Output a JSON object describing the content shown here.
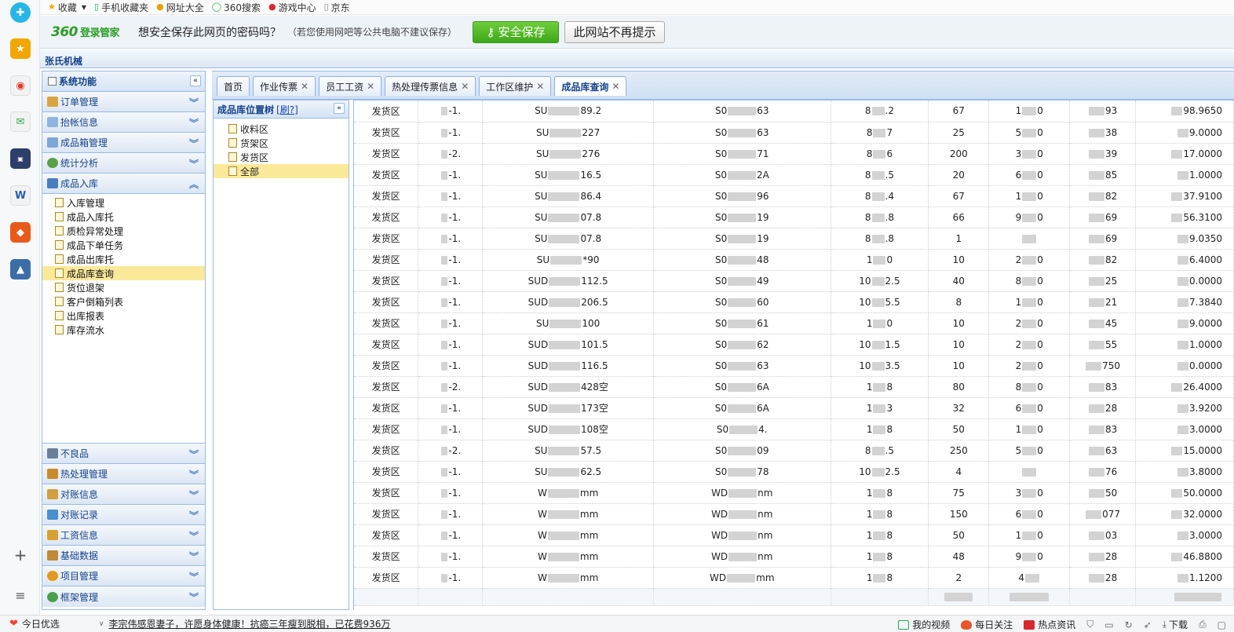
{
  "favorites": {
    "items": [
      {
        "label": "收藏",
        "icon": "star-icon"
      },
      {
        "label": "手机收藏夹",
        "icon": "phone-icon"
      },
      {
        "label": "网址大全",
        "icon": "web-directory-icon"
      },
      {
        "label": "360搜索",
        "icon": "search-360-icon"
      },
      {
        "label": "游戏中心",
        "icon": "game-center-icon"
      },
      {
        "label": "京东",
        "icon": "page-icon"
      }
    ]
  },
  "notice": {
    "brand": "360",
    "brand_sub": "登录管家",
    "question": "想安全保存此网页的密码吗？",
    "hint": "（若您使用网吧等公共电脑不建议保存）",
    "save_button": "安全保存",
    "never_button": "此网站不再提示"
  },
  "app": {
    "title": "张氏机械"
  },
  "menu": {
    "header": "系统功能",
    "sections_top": [
      {
        "label": "订单管理",
        "icon": "order-icon",
        "color": "#d9a441"
      },
      {
        "label": "抬帐信息",
        "icon": "mail-icon",
        "color": "#8fb4de"
      },
      {
        "label": "成品箱管理",
        "icon": "box-icon",
        "color": "#7ea6d6"
      },
      {
        "label": "统计分析",
        "icon": "pie-chart-icon",
        "color": "#5aa04a"
      }
    ],
    "open_section": {
      "label": "成品入库",
      "icon": "book-icon"
    },
    "sub_items": [
      "入库管理",
      "成品入库托",
      "质检异常处理",
      "成品下单任务",
      "成品出库托",
      "成品库查询",
      "货位退架",
      "客户倒箱列表",
      "出库报表",
      "库存流水"
    ],
    "selected_sub": "成品库查询",
    "sections_bottom": [
      {
        "label": "不良品",
        "icon": "user-icon",
        "color": "#6b7f99"
      },
      {
        "label": "热处理管理",
        "icon": "folder-icon",
        "color": "#c98a2c"
      },
      {
        "label": "对账信息",
        "icon": "edit-icon",
        "color": "#d0a040"
      },
      {
        "label": "对账记录",
        "icon": "check-icon",
        "color": "#4a8fd0"
      },
      {
        "label": "工资信息",
        "icon": "people-icon",
        "color": "#d8a030"
      },
      {
        "label": "基础数据",
        "icon": "wrench-icon",
        "color": "#c08a3a"
      },
      {
        "label": "项目管理",
        "icon": "gear-icon",
        "color": "#e29a1e"
      },
      {
        "label": "框架管理",
        "icon": "plus-circle-icon",
        "color": "#4aa04a"
      }
    ]
  },
  "tabs": [
    {
      "label": "首页",
      "closable": false
    },
    {
      "label": "作业传票",
      "closable": true
    },
    {
      "label": "员工工资",
      "closable": true
    },
    {
      "label": "热处理传票信息",
      "closable": true
    },
    {
      "label": "工作区维护",
      "closable": true
    },
    {
      "label": "成品库查询",
      "closable": true,
      "active": true
    }
  ],
  "tree": {
    "title": "成品库位置树",
    "refresh_label": "[刷?]",
    "nodes": [
      "收料区",
      "货架区",
      "发货区",
      "全部"
    ],
    "selected": "全部"
  },
  "grid": {
    "rows": [
      [
        "发货区",
        "-1.",
        "SU",
        "89.2",
        "S0",
        "63",
        "8",
        ".2",
        "67",
        "1",
        "0",
        "93",
        "98.9650"
      ],
      [
        "发货区",
        "-1.",
        "SU",
        "227",
        "S0",
        "63",
        "8",
        "7",
        "25",
        "5",
        "0",
        "38",
        "9.0000"
      ],
      [
        "发货区",
        "-2.",
        "SU",
        "276",
        "S0",
        "71",
        "8",
        "6",
        "200",
        "3",
        "0",
        "39",
        "17.0000"
      ],
      [
        "发货区",
        "-1.",
        "SU",
        "16.5",
        "S0",
        "2A",
        "8",
        ".5",
        "20",
        "6",
        "0",
        "85",
        "1.0000"
      ],
      [
        "发货区",
        "-1.",
        "SU",
        "86.4",
        "S0",
        "96",
        "8",
        ".4",
        "67",
        "1",
        "0",
        "82",
        "37.9100"
      ],
      [
        "发货区",
        "-1.",
        "SU",
        "07.8",
        "S0",
        "19",
        "8",
        ".8",
        "66",
        "9",
        "0",
        "69",
        "56.3100"
      ],
      [
        "发货区",
        "-1.",
        "SU",
        "07.8",
        "S0",
        "19",
        "8",
        ".8",
        "1",
        "",
        "",
        "69",
        "9.0350"
      ],
      [
        "发货区",
        "-1.",
        "SU",
        "*90",
        "S0",
        "48",
        "1",
        "0",
        "10",
        "2",
        "0",
        "82",
        "6.4000"
      ],
      [
        "发货区",
        "-1.",
        "SUD",
        "112.5",
        "S0",
        "49",
        "10",
        "2.5",
        "40",
        "8",
        "0",
        "25",
        "0.0000"
      ],
      [
        "发货区",
        "-1.",
        "SUD",
        "206.5",
        "S0",
        "60",
        "10",
        "5.5",
        "8",
        "1",
        "0",
        "21",
        "7.3840"
      ],
      [
        "发货区",
        "-1.",
        "SU",
        "100",
        "S0",
        "61",
        "1",
        "0",
        "10",
        "2",
        "0",
        "45",
        "9.0000"
      ],
      [
        "发货区",
        "-1.",
        "SUD",
        "101.5",
        "S0",
        "62",
        "10",
        "1.5",
        "10",
        "2",
        "0",
        "55",
        "1.0000"
      ],
      [
        "发货区",
        "-1.",
        "SUD",
        "116.5",
        "S0",
        "63",
        "10",
        "3.5",
        "10",
        "2",
        "0",
        "750",
        "0.0000"
      ],
      [
        "发货区",
        "-2.",
        "SUD",
        "428空",
        "S0",
        "6A",
        "1",
        "8",
        "80",
        "8",
        "0",
        "83",
        "26.4000"
      ],
      [
        "发货区",
        "-1.",
        "SUD",
        "173空",
        "S0",
        "6A",
        "1",
        "3",
        "32",
        "6",
        "0",
        "28",
        "3.9200"
      ],
      [
        "发货区",
        "-1.",
        "SUD",
        "108空",
        "S0",
        "4.",
        "1",
        "8",
        "50",
        "1",
        "0",
        "83",
        "3.0000"
      ],
      [
        "发货区",
        "-2.",
        "SU",
        "57.5",
        "S0",
        "09",
        "8",
        ".5",
        "250",
        "5",
        "0",
        "63",
        "15.0000"
      ],
      [
        "发货区",
        "-1.",
        "SU",
        "62.5",
        "S0",
        "78",
        "10",
        "2.5",
        "4",
        "",
        "",
        "76",
        "3.8000"
      ],
      [
        "发货区",
        "-1.",
        "W",
        "mm",
        "WD",
        "nm",
        "1",
        "8",
        "75",
        "3",
        "0",
        "50",
        "50.0000"
      ],
      [
        "发货区",
        "-1.",
        "W",
        "mm",
        "WD",
        "nm",
        "1",
        "8",
        "150",
        "6",
        "0",
        "077",
        "32.0000"
      ],
      [
        "发货区",
        "-1.",
        "W",
        "mm",
        "WD",
        "nm",
        "1",
        "8",
        "50",
        "1",
        "0",
        "03",
        "3.0000"
      ],
      [
        "发货区",
        "-1.",
        "W",
        "mm",
        "WD",
        "nm",
        "1",
        "8",
        "48",
        "9",
        "0",
        "28",
        "46.8800"
      ],
      [
        "发货区",
        "-1.",
        "W",
        "mm",
        "WD",
        "mm",
        "1",
        "8",
        "2",
        "4",
        "",
        "28",
        "1.1200"
      ]
    ]
  },
  "statusbar": {
    "today": "今日优选",
    "news": "李宗伟感恩妻子，许愿身体健康！抗癌三年瘦到脱相，已花费936万",
    "right_items": [
      "我的视频",
      "每日关注",
      "热点资讯"
    ],
    "download": "下载"
  },
  "colors": {
    "accent_green": "#3fa718",
    "panel_border": "#99bbe8",
    "selected": "#fbe99a"
  }
}
